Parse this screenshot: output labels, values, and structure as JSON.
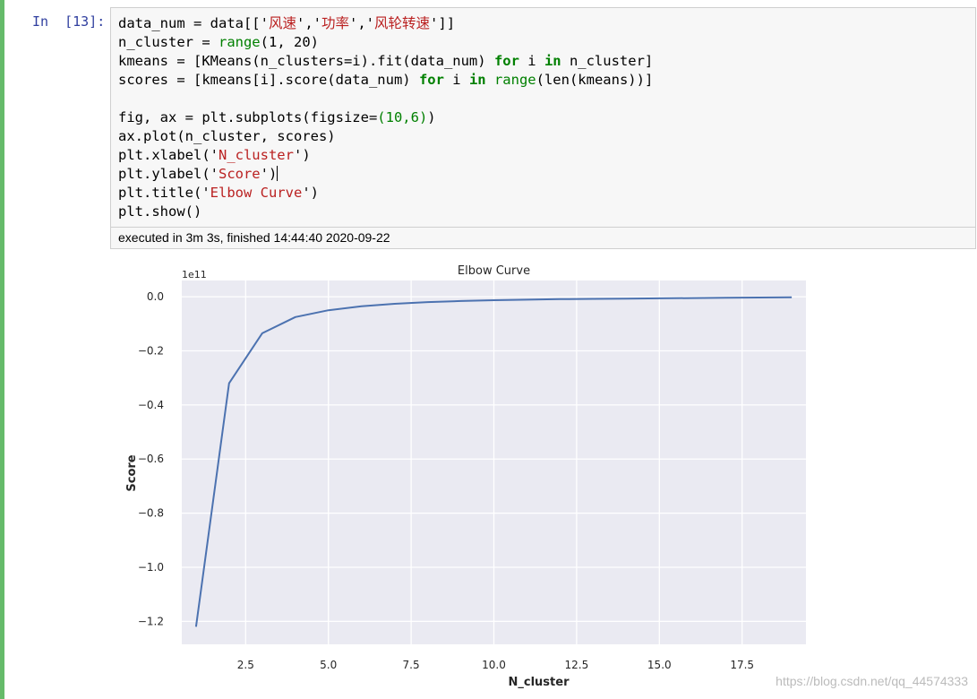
{
  "cell": {
    "prompt": "In  [13]:",
    "code_lines": [
      [
        {
          "t": "data_num = data[['"
        },
        {
          "t": "风速",
          "c": "str"
        },
        {
          "t": "','"
        },
        {
          "t": "功率",
          "c": "str"
        },
        {
          "t": "','"
        },
        {
          "t": "风轮转速",
          "c": "str"
        },
        {
          "t": "']]"
        }
      ],
      [
        {
          "t": "n_cluster = "
        },
        {
          "t": "range",
          "c": "bi"
        },
        {
          "t": "(1, 20)"
        }
      ],
      [
        {
          "t": "kmeans = [KMeans(n_clusters=i).fit(data_num) "
        },
        {
          "t": "for",
          "c": "kw"
        },
        {
          "t": " i "
        },
        {
          "t": "in",
          "c": "kw"
        },
        {
          "t": " n_cluster]"
        }
      ],
      [
        {
          "t": "scores = [kmeans[i].score(data_num) "
        },
        {
          "t": "for",
          "c": "kw"
        },
        {
          "t": " i "
        },
        {
          "t": "in",
          "c": "kw"
        },
        {
          "t": " "
        },
        {
          "t": "range",
          "c": "bi"
        },
        {
          "t": "(len(kmeans))]"
        }
      ],
      [
        {
          "t": ""
        }
      ],
      [
        {
          "t": "fig, ax = plt.subplots(figsize="
        },
        {
          "t": "(10,6)",
          "c": "num"
        },
        {
          "t": ")"
        }
      ],
      [
        {
          "t": "ax.plot(n_cluster, scores)"
        }
      ],
      [
        {
          "t": "plt.xlabel('"
        },
        {
          "t": "N_cluster",
          "c": "str"
        },
        {
          "t": "')"
        }
      ],
      [
        {
          "t": "plt.ylabel('"
        },
        {
          "t": "Score",
          "c": "str"
        },
        {
          "t": "')"
        },
        {
          "t": "",
          "c": "cursor"
        }
      ],
      [
        {
          "t": "plt.title('"
        },
        {
          "t": "Elbow Curve",
          "c": "str"
        },
        {
          "t": "')"
        }
      ],
      [
        {
          "t": "plt.show()"
        }
      ]
    ],
    "exec_info": "executed in 3m 3s, finished 14:44:40 2020-09-22"
  },
  "chart_data": {
    "type": "line",
    "title": "Elbow Curve",
    "xlabel": "N_cluster",
    "ylabel": "Score",
    "y_offset_label": "1e11",
    "x": [
      1,
      2,
      3,
      4,
      5,
      6,
      7,
      8,
      9,
      10,
      11,
      12,
      13,
      14,
      15,
      16,
      17,
      18,
      19
    ],
    "series": [
      {
        "values": [
          -1.22,
          -0.32,
          -0.135,
          -0.075,
          -0.05,
          -0.035,
          -0.026,
          -0.02,
          -0.016,
          -0.013,
          -0.011,
          -0.009,
          -0.008,
          -0.007,
          -0.006,
          -0.005,
          -0.004,
          -0.003,
          -0.002
        ]
      }
    ],
    "xlim": [
      0.57,
      19.43
    ],
    "ylim": [
      -1.285,
      0.06
    ],
    "xticks": [
      2.5,
      5.0,
      7.5,
      10.0,
      12.5,
      15.0,
      17.5
    ],
    "xtick_labels": [
      "2.5",
      "5.0",
      "7.5",
      "10.0",
      "12.5",
      "15.0",
      "17.5"
    ],
    "yticks": [
      0.0,
      -0.2,
      -0.4,
      -0.6,
      -0.8,
      -1.0,
      -1.2
    ],
    "ytick_labels": [
      "0.0",
      "−0.2",
      "−0.4",
      "−0.6",
      "−0.8",
      "−1.0",
      "−1.2"
    ],
    "grid": true,
    "colors": {
      "background": "#eaeaf2",
      "grid": "#ffffff",
      "line": "#4c72b0",
      "text": "#262626"
    }
  },
  "watermark": "https://blog.csdn.net/qq_44574333"
}
